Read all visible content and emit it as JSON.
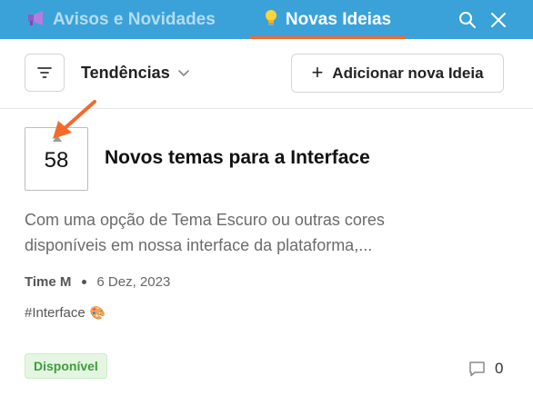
{
  "tabs": [
    {
      "label": "Avisos e Novidades",
      "icon": "megaphone-icon",
      "active": false
    },
    {
      "label": "Novas Ideias",
      "icon": "lightbulb-icon",
      "active": true
    }
  ],
  "top_actions": [
    "search-icon",
    "close-icon"
  ],
  "toolbar": {
    "filter_icon": "filter-icon",
    "sort_label": "Tendências",
    "add_label": "Adicionar nova Ideia"
  },
  "idea": {
    "votes": "58",
    "title": "Novos temas para a Interface",
    "description": "Com uma opção de Tema Escuro ou outras cores disponíveis em nossa interface da plataforma,...",
    "author": "Time M",
    "date": "6 Dez, 2023",
    "tag": "#Interface",
    "tag_emoji": "🎨",
    "status": "Disponível",
    "comments": "0"
  },
  "colors": {
    "topbar": "#3aa2d9",
    "active_tab_underline": "#f46a2b",
    "annotation_arrow": "#f46a2b",
    "status_bg": "#e4f6e2",
    "status_text": "#3d9e3a"
  }
}
